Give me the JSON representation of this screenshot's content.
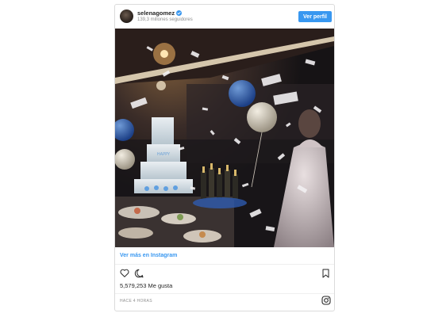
{
  "post": {
    "username": "selenagomez",
    "followers": "139,3 millones seguidores",
    "follow_label": "Ver perfil",
    "more_link": "Ver más en Instagram",
    "likes": "5,579,253 Me gusta",
    "time": "HACE 4 HORAS"
  },
  "icons": {
    "verified": "verified-badge-icon",
    "like": "heart-icon",
    "comment": "comment-bubble-icon",
    "save": "bookmark-icon",
    "brand": "instagram-logo-icon"
  },
  "colors": {
    "accent": "#3897f0",
    "text": "#262626",
    "muted": "#8e8e8e",
    "border": "#dbdbdb"
  }
}
